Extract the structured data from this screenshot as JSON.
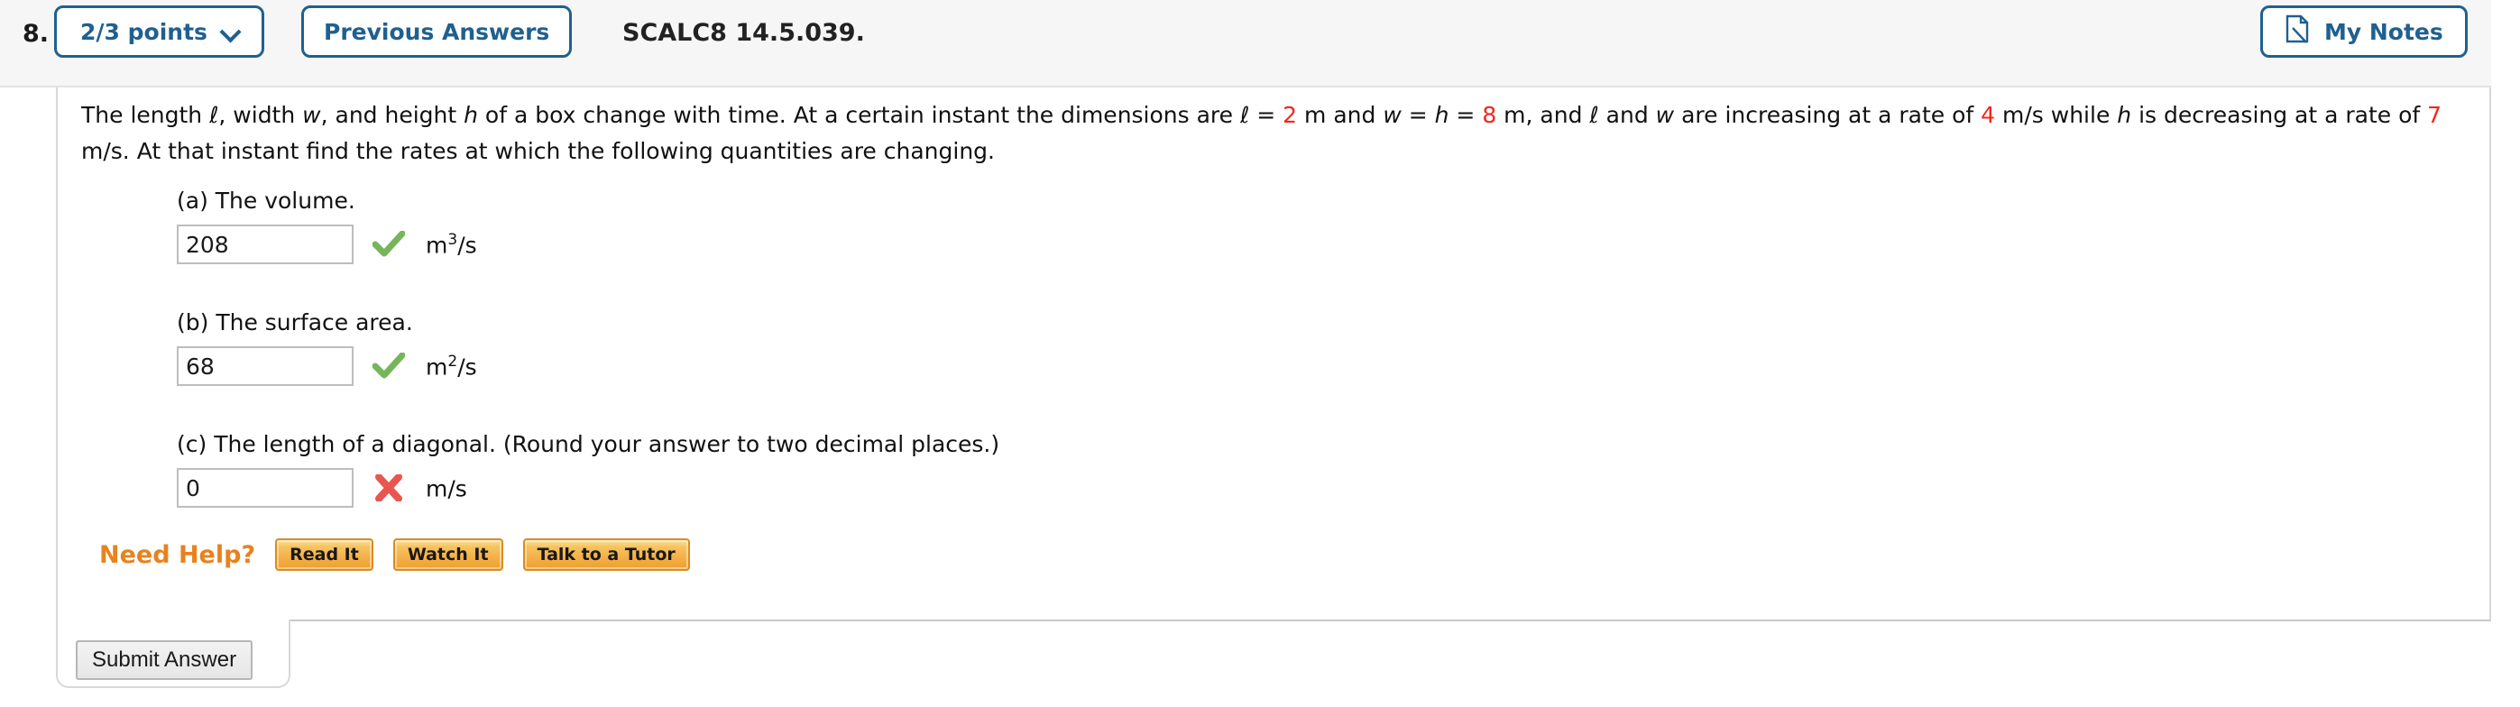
{
  "header": {
    "question_number": "8.",
    "points_label": "2/3 points",
    "points_chevron_icon": "chevron-down-icon",
    "previous_answers_label": "Previous Answers",
    "question_code": "SCALC8 14.5.039.",
    "my_notes_label": "My Notes",
    "my_notes_icon": "note-page-icon"
  },
  "problem": {
    "line1_a": "The length ",
    "var_l": "ℓ",
    "line1_b": ", width ",
    "var_w": "w",
    "line1_c": ", and height ",
    "var_h": "h",
    "line1_d": " of a box change with time. At a certain instant the dimensions are ",
    "var_l2": "ℓ",
    "eq1": " = ",
    "val_l": "2",
    "unit_m1": " m and  ",
    "var_w2": "w",
    "eq2": " = ",
    "var_h2": "h",
    "eq3": " = ",
    "val_wh": "8",
    "unit_m2": " m,  and ",
    "var_l3": "ℓ",
    "and_txt": " and ",
    "var_w3": "w",
    "rate_txt": " are increasing at a rate of ",
    "val_rate_lw": "4",
    "rate_txt2": " m/s while ",
    "var_h3": "h",
    "rate_txt3": " is decreasing at a rate of ",
    "val_rate_h": "7",
    "rate_txt4": " m/s. At that instant find the rates at which the following quantities are changing."
  },
  "parts": [
    {
      "label": "(a) The volume.",
      "value": "208",
      "mark": "correct-check-icon",
      "unit_base": "m",
      "unit_sup": "3",
      "unit_tail": "/s"
    },
    {
      "label": "(b) The surface area.",
      "value": "68",
      "mark": "correct-check-icon",
      "unit_base": "m",
      "unit_sup": "2",
      "unit_tail": "/s"
    },
    {
      "label": "(c) The length of a diagonal. (Round your answer to two decimal places.)",
      "value": "0",
      "mark": "incorrect-x-icon",
      "unit_base": "m",
      "unit_sup": "",
      "unit_tail": "/s"
    }
  ],
  "need_help": {
    "label": "Need Help?",
    "buttons": [
      {
        "label": "Read It"
      },
      {
        "label": "Watch It"
      },
      {
        "label": "Talk to a Tutor"
      }
    ]
  },
  "submit": {
    "label": "Submit Answer"
  },
  "colors": {
    "accent_blue": "#1f6090",
    "red_value": "#f2271c",
    "help_orange": "#e8821e",
    "correct_green": "#77b55a",
    "incorrect_red": "#e8564f"
  }
}
